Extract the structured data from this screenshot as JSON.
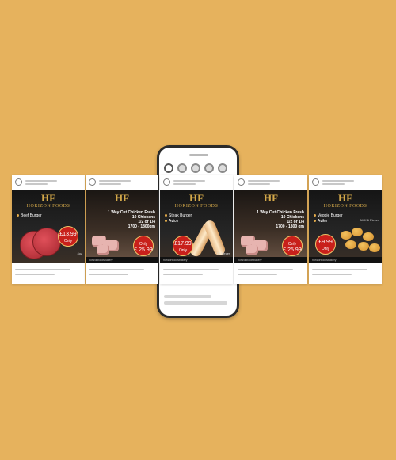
{
  "colors": {
    "background": "#e6b25d",
    "brand_gold": "#d4a94a",
    "badge_red": "#c8201b"
  },
  "brand": {
    "monogram": "HF",
    "name": "HORIZON FOODS"
  },
  "posts": [
    {
      "product": "Beef Burger",
      "price": "£13.99",
      "price_note": "Only",
      "corner": "4oz"
    },
    {
      "offer_lines": [
        "1 Way Cut Chicken Fresh",
        "10 Chickens",
        "1/2 or 1/4",
        "1700 - 1800gm"
      ],
      "price": "£ 25.99",
      "price_note": "Only",
      "footer_handle": "horizonfoodsbakery"
    },
    {
      "products": [
        "Steak Burger",
        "Avico"
      ],
      "price": "£17.99",
      "price_note": "Only",
      "corner": "72 Pieces",
      "footer_handle": "horizonfoodsbakery"
    },
    {
      "offer_lines": [
        "1 Way Cut Chicken Fresh",
        "10 Chickens",
        "1/2 or 1/4",
        "1700 - 1800 gm"
      ],
      "price": "£ 25.99",
      "price_note": "Only",
      "footer_handle": "horizonfoodsbakery"
    },
    {
      "products": [
        "Veggie Burger",
        "Aviko"
      ],
      "price": "£9.99",
      "price_note": "Only",
      "corner": "54 X 6 Pieces",
      "footer_handle": "horizonfoodsbakery"
    }
  ]
}
